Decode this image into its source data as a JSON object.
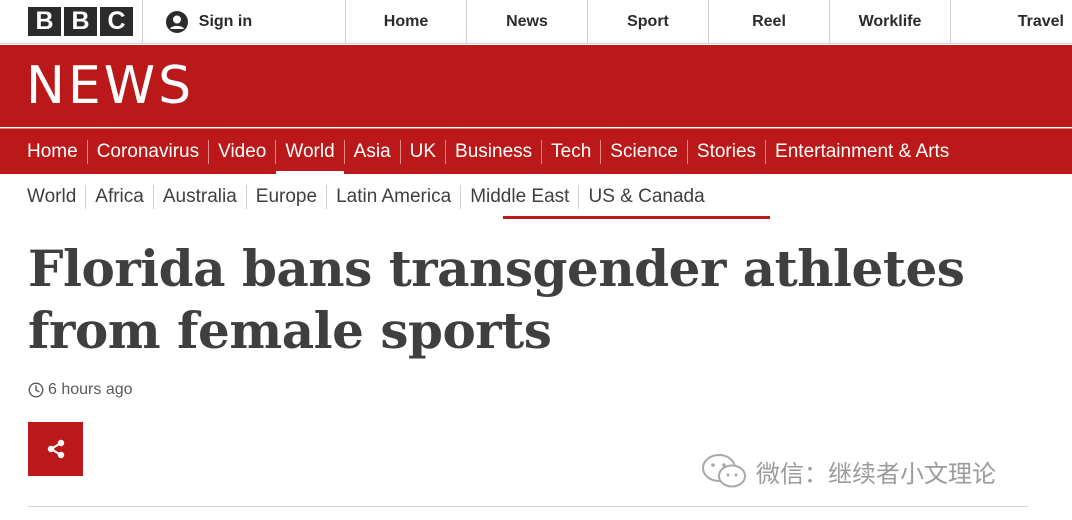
{
  "brand": {
    "letters": [
      "B",
      "B",
      "C"
    ],
    "section_word": "NEWS",
    "accent_color": "#bb1919"
  },
  "account": {
    "icon": "user-icon",
    "signin_label": "Sign in"
  },
  "top_nav": {
    "items": [
      "Home",
      "News",
      "Sport",
      "Reel",
      "Worklife",
      "Travel"
    ]
  },
  "main_nav": {
    "items": [
      "Home",
      "Coronavirus",
      "Video",
      "World",
      "Asia",
      "UK",
      "Business",
      "Tech",
      "Science",
      "Stories",
      "Entertainment & Arts"
    ],
    "active": "World"
  },
  "sub_nav": {
    "items": [
      "World",
      "Africa",
      "Australia",
      "Europe",
      "Latin America",
      "Middle East",
      "US & Canada"
    ]
  },
  "article": {
    "headline_line1": "Florida bans transgender athletes",
    "headline_line2": "from female sports",
    "timestamp": "6 hours ago",
    "timestamp_icon": "clock-icon",
    "share_icon": "share-icon"
  },
  "watermark": {
    "icon": "wechat-icon",
    "text": "微信：继续者小文理论"
  }
}
